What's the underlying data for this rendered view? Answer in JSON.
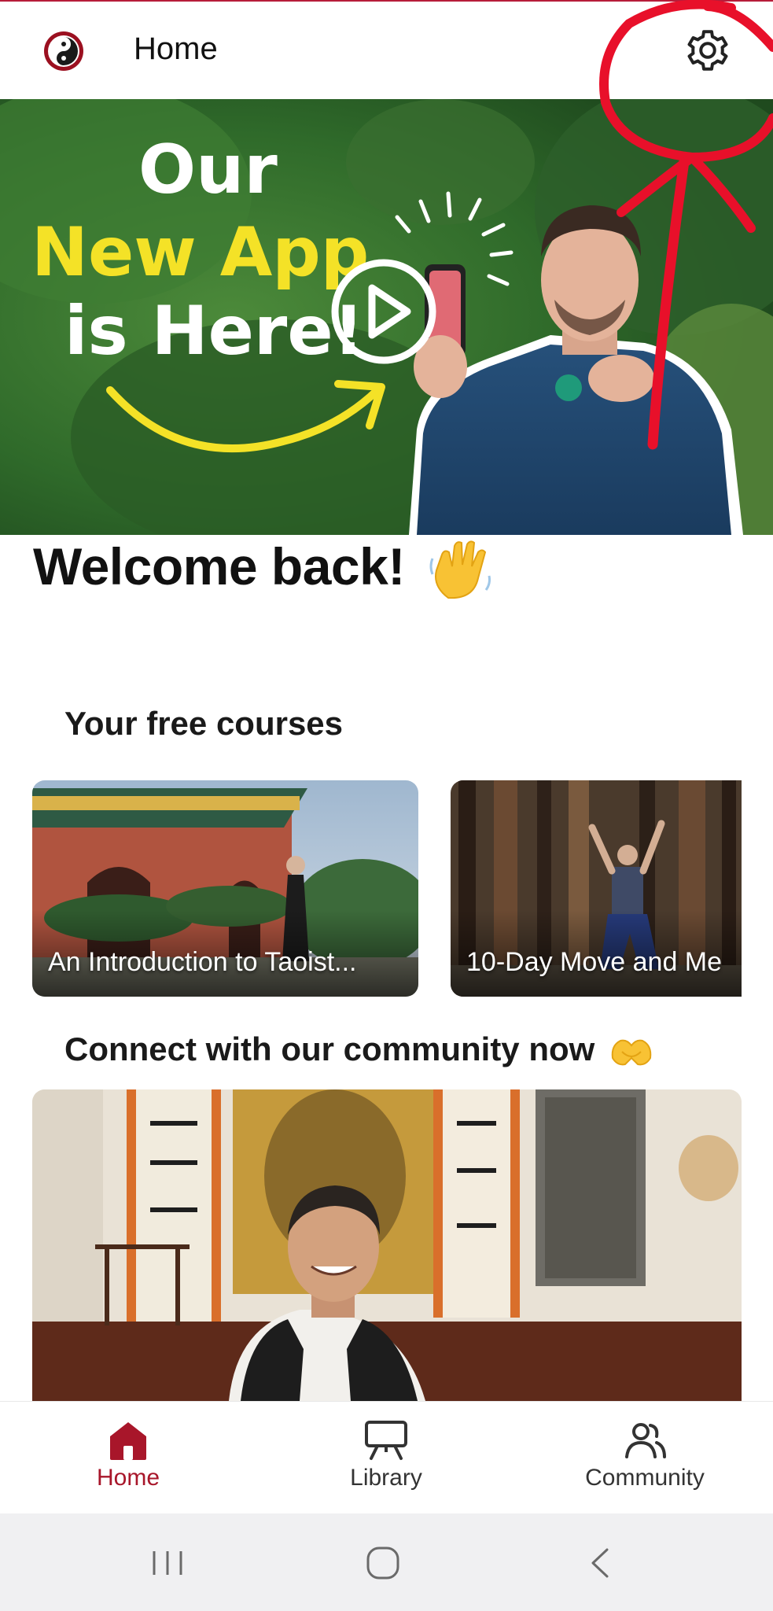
{
  "header": {
    "title": "Home",
    "logo_icon": "yin-yang-logo-icon",
    "settings_icon": "gear-icon"
  },
  "hero": {
    "line1": "Our",
    "line2": "New App",
    "line3": "is Here!",
    "play_icon": "play-icon",
    "annotation_color": "#e8102a"
  },
  "welcome": {
    "text": "Welcome back!",
    "emoji_icon": "waving-hand-icon"
  },
  "free_courses": {
    "title": "Your free courses",
    "cards": [
      {
        "label": "An Introduction to Taoist..."
      },
      {
        "label": "10-Day Move and Me"
      }
    ]
  },
  "community": {
    "title": "Connect with our community now",
    "emoji_icon": "heart-hands-icon"
  },
  "bottom_nav": {
    "items": [
      {
        "label": "Home",
        "icon": "home-icon",
        "active": true
      },
      {
        "label": "Library",
        "icon": "presentation-board-icon",
        "active": false
      },
      {
        "label": "Community",
        "icon": "users-icon",
        "active": false
      }
    ],
    "active_color": "#a8162a"
  },
  "system_nav": {
    "recents_icon": "recents-icon",
    "home_icon": "home-circle-icon",
    "back_icon": "back-chevron-icon"
  }
}
